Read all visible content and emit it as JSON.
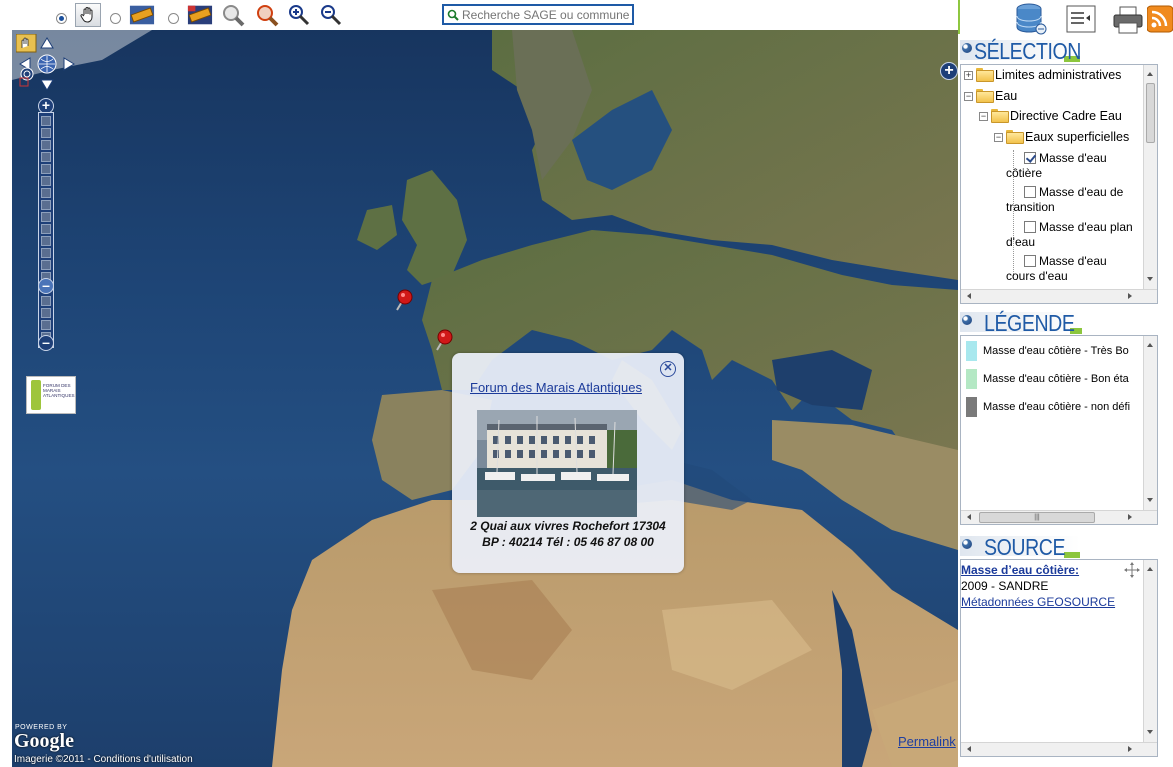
{
  "toolbar": {
    "tools": [
      "hand-tool",
      "ruler-tool",
      "area-tool",
      "zoom-box-tool",
      "zoom-box-minus-tool",
      "zoom-in-tool",
      "zoom-out-tool"
    ],
    "search_placeholder": "Recherche SAGE ou commune"
  },
  "map": {
    "popup": {
      "title": "Forum des Marais Atlantiques",
      "address_line1": "2 Quai aux vivres Rochefort 17304",
      "address_line2": "BP : 40214 Tél : 05 46 87 08 00"
    },
    "logo_text": "FORUM DES MARAIS ATLANTIQUES",
    "powered_by": "POWERED BY",
    "google": "Google",
    "copyright": "Imagerie ©2011 - Conditions d'utilisation",
    "permalink": "Permalink"
  },
  "right_panel": {
    "selection": {
      "title": "SÉLECTION",
      "tree": {
        "limites": "Limites administratives",
        "eau": "Eau",
        "dce": "Directive Cadre Eau",
        "eaux_sup": "Eaux superficielles",
        "items": [
          {
            "line1": "Masse d'eau",
            "line2": "côtière",
            "checked": true
          },
          {
            "line1": "Masse d'eau de",
            "line2": "transition",
            "checked": false
          },
          {
            "line1": "Masse d'eau plan",
            "line2": "d'eau",
            "checked": false
          },
          {
            "line1": "Masse d'eau",
            "line2": "cours d'eau",
            "checked": false
          }
        ]
      }
    },
    "legende": {
      "title": "LÉGENDE",
      "items": [
        {
          "label": "Masse d'eau côtière - Très Bo",
          "color": "#a8e8ee"
        },
        {
          "label": "Masse d'eau côtière - Bon éta",
          "color": "#b4e8c4"
        },
        {
          "label": "Masse d'eau côtière - non défi",
          "color": "#7a7a7a"
        }
      ]
    },
    "source": {
      "title": "SOURCE",
      "layer": "Masse d’eau côtière:",
      "line": "2009 - SANDRE",
      "link": "Métadonnées GEOSOURCE"
    }
  }
}
